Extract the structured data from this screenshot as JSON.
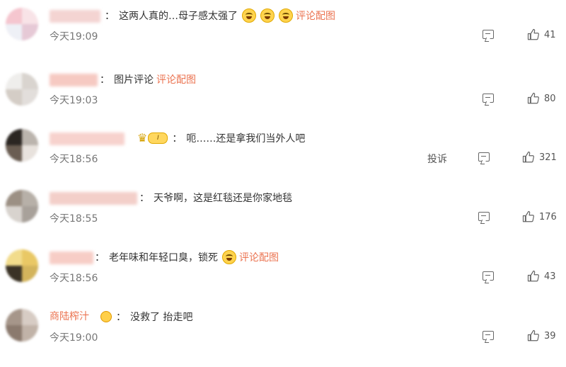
{
  "comments": [
    {
      "name": "",
      "text": "这两人真的…母子感太强了",
      "emojis": 3,
      "link": "评论配图",
      "time": "今天19:09",
      "likes": "41"
    },
    {
      "name": "",
      "text": "图片评论",
      "link": "评论配图",
      "time": "今天19:03",
      "likes": "80"
    },
    {
      "name": "",
      "badge_level": "I",
      "text": "呃……还是拿我们当外人吧",
      "time": "今天18:56",
      "report": "投诉",
      "likes": "321"
    },
    {
      "name": "",
      "text": "天爷啊，这是红毯还是你家地毯",
      "time": "今天18:55",
      "likes": "176"
    },
    {
      "name": "",
      "text": "老年味和年轻口臭，锁死",
      "link": "评论配图",
      "time": "今天18:56",
      "likes": "43"
    },
    {
      "name": "商陆榨汁",
      "text": "没救了 抬走吧",
      "time": "今天19:00",
      "likes": "39"
    }
  ],
  "icons": {
    "reply": "reply-icon",
    "like": "thumbs-up-icon",
    "emoji": "emoji-icon",
    "crown": "crown-badge-icon"
  },
  "colors": {
    "link": "#eb7350",
    "time": "#777777",
    "text": "#333333"
  }
}
